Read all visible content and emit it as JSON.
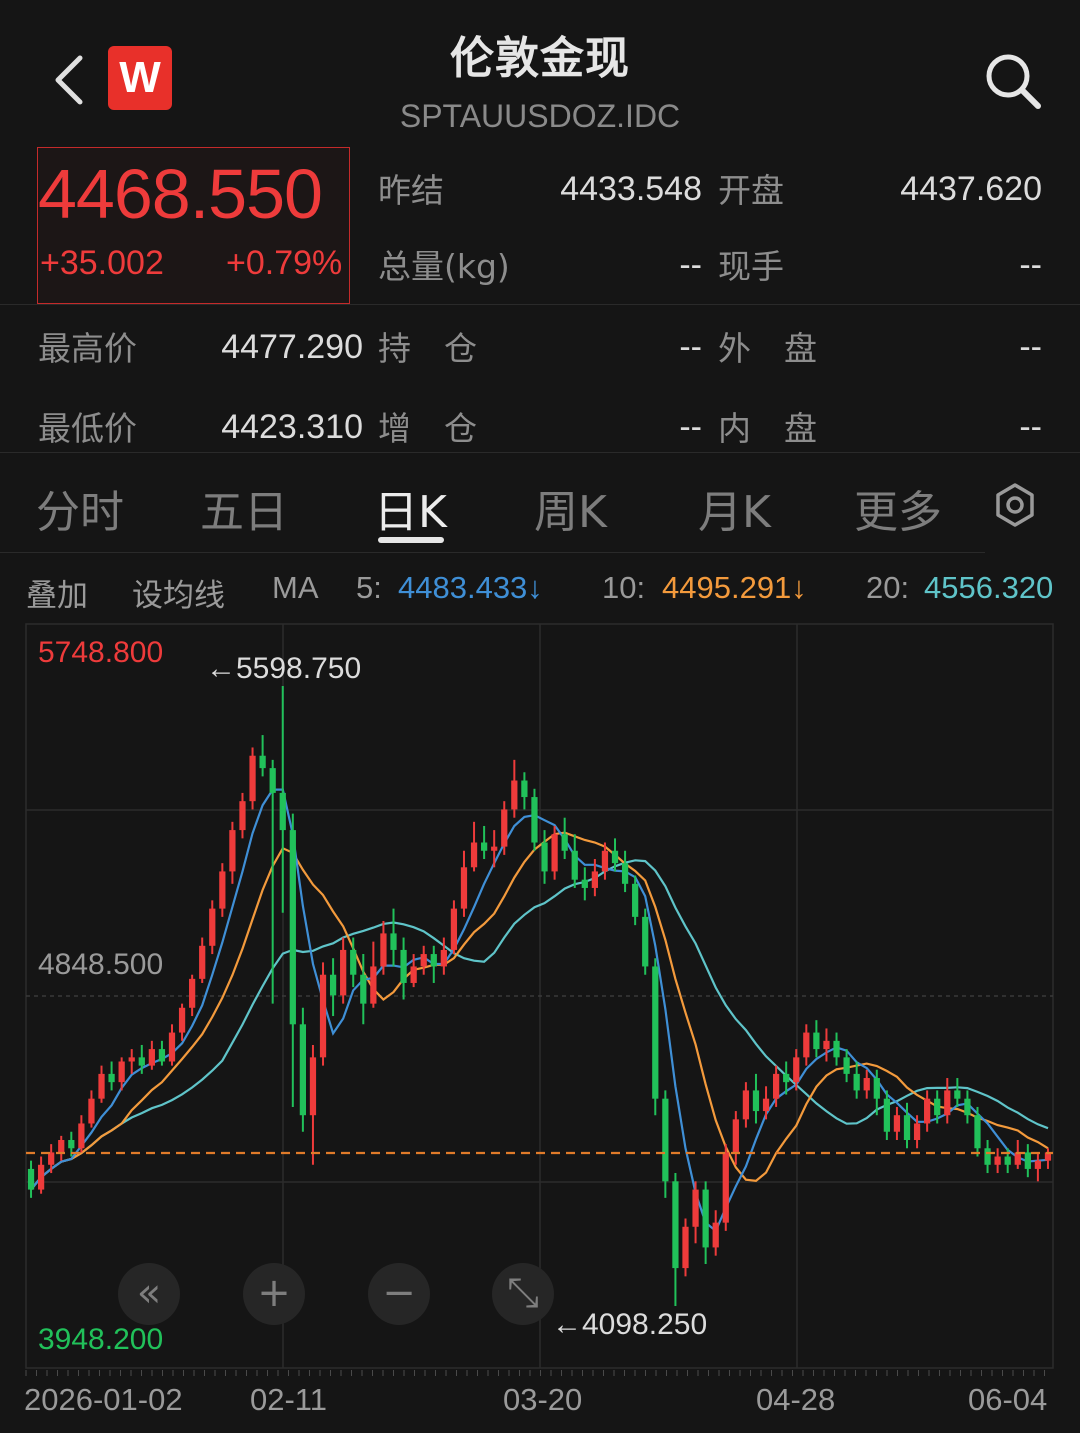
{
  "header": {
    "title": "伦敦金现",
    "code": "SPTAUUSDOZ.IDC",
    "logo_letter": "W"
  },
  "quote": {
    "price": "4468.550",
    "change": "+35.002",
    "change_pct": "+0.79%",
    "prev_close_label": "昨结",
    "prev_close": "4433.548",
    "open_label": "开盘",
    "open": "4437.620",
    "volume_label": "总量(kg)",
    "volume": "--",
    "hand_label": "现手",
    "hand": "--",
    "high_label": "最高价",
    "high": "4477.290",
    "hold_label": "持　仓",
    "hold": "--",
    "outer_label": "外　盘",
    "outer": "--",
    "low_label": "最低价",
    "low": "4423.310",
    "add_label": "增　仓",
    "add": "--",
    "inner_label": "内　盘",
    "inner": "--"
  },
  "tabs": [
    {
      "label": "分时",
      "active": false
    },
    {
      "label": "五日",
      "active": false
    },
    {
      "label": "日K",
      "active": true
    },
    {
      "label": "周K",
      "active": false
    },
    {
      "label": "月K",
      "active": false
    },
    {
      "label": "更多",
      "active": false
    }
  ],
  "ma_bar": {
    "overlay_label": "叠加",
    "setting_label": "设均线",
    "ma_label": "MA",
    "ma5_label": "5:",
    "ma5": "4483.433↓",
    "ma10_label": "10:",
    "ma10": "4495.291↓",
    "ma20_label": "20:",
    "ma20": "4556.320"
  },
  "colors": {
    "up": "#ee3b3b",
    "down": "#21c15a",
    "ma5": "#3f8fd6",
    "ma10": "#f39a3c",
    "ma20": "#5fc4c9",
    "last_line": "#e07b2a"
  },
  "chart_data": {
    "type": "candlestick",
    "y_top_label": "5748.800",
    "y_mid_label": "4848.500",
    "y_bottom_label": "3948.200",
    "ylim": [
      3948.2,
      5748.8
    ],
    "max_annotation": "5598.750",
    "min_annotation": "4098.250",
    "x_tick_labels": [
      "2026-01-02",
      "02-11",
      "03-20",
      "04-28",
      "06-04"
    ],
    "last_price": 4468.55,
    "candles": [
      [
        4430,
        4380,
        4450,
        4360
      ],
      [
        4380,
        4440,
        4460,
        4370
      ],
      [
        4440,
        4470,
        4490,
        4420
      ],
      [
        4470,
        4500,
        4510,
        4450
      ],
      [
        4500,
        4480,
        4520,
        4460
      ],
      [
        4480,
        4540,
        4560,
        4470
      ],
      [
        4540,
        4600,
        4620,
        4530
      ],
      [
        4600,
        4660,
        4680,
        4590
      ],
      [
        4660,
        4640,
        4690,
        4620
      ],
      [
        4640,
        4690,
        4700,
        4620
      ],
      [
        4690,
        4700,
        4720,
        4660
      ],
      [
        4700,
        4680,
        4730,
        4660
      ],
      [
        4680,
        4720,
        4740,
        4670
      ],
      [
        4720,
        4690,
        4740,
        4680
      ],
      [
        4690,
        4760,
        4780,
        4680
      ],
      [
        4760,
        4820,
        4830,
        4740
      ],
      [
        4820,
        4890,
        4900,
        4800
      ],
      [
        4890,
        4970,
        4990,
        4880
      ],
      [
        4970,
        5060,
        5080,
        4950
      ],
      [
        5060,
        5150,
        5170,
        5040
      ],
      [
        5150,
        5250,
        5270,
        5120
      ],
      [
        5250,
        5320,
        5340,
        5230
      ],
      [
        5320,
        5430,
        5450,
        5300
      ],
      [
        5430,
        5400,
        5480,
        5380
      ],
      [
        5400,
        5340,
        5420,
        4830
      ],
      [
        5340,
        5250,
        5598.75,
        5050
      ],
      [
        5250,
        4780,
        5290,
        4580
      ],
      [
        4780,
        4560,
        4820,
        4520
      ],
      [
        4560,
        4700,
        4730,
        4440
      ],
      [
        4700,
        4900,
        4930,
        4680
      ],
      [
        4900,
        4850,
        4940,
        4800
      ],
      [
        4850,
        4960,
        4990,
        4830
      ],
      [
        4960,
        4900,
        4990,
        4870
      ],
      [
        4900,
        4830,
        4950,
        4780
      ],
      [
        4830,
        4920,
        4980,
        4820
      ],
      [
        4920,
        5000,
        5030,
        4900
      ],
      [
        5000,
        4960,
        5060,
        4920
      ],
      [
        4960,
        4880,
        4990,
        4840
      ],
      [
        4880,
        4920,
        4950,
        4870
      ],
      [
        4920,
        4950,
        4970,
        4900
      ],
      [
        4950,
        4920,
        4970,
        4880
      ],
      [
        4920,
        4960,
        4990,
        4900
      ],
      [
        4960,
        5060,
        5080,
        4950
      ],
      [
        5060,
        5160,
        5200,
        5040
      ],
      [
        5160,
        5220,
        5270,
        5150
      ],
      [
        5220,
        5200,
        5260,
        5180
      ],
      [
        5200,
        5210,
        5250,
        5160
      ],
      [
        5210,
        5300,
        5320,
        5190
      ],
      [
        5300,
        5370,
        5420,
        5280
      ],
      [
        5370,
        5330,
        5390,
        5300
      ],
      [
        5330,
        5220,
        5350,
        5200
      ],
      [
        5220,
        5150,
        5250,
        5120
      ],
      [
        5150,
        5240,
        5260,
        5130
      ],
      [
        5240,
        5200,
        5280,
        5180
      ],
      [
        5200,
        5130,
        5240,
        5110
      ],
      [
        5130,
        5110,
        5160,
        5080
      ],
      [
        5110,
        5150,
        5180,
        5090
      ],
      [
        5150,
        5200,
        5220,
        5130
      ],
      [
        5200,
        5170,
        5230,
        5150
      ],
      [
        5170,
        5120,
        5200,
        5100
      ],
      [
        5120,
        5040,
        5140,
        5020
      ],
      [
        5040,
        4920,
        5060,
        4900
      ],
      [
        4920,
        4600,
        4940,
        4560
      ],
      [
        4600,
        4400,
        4620,
        4360
      ],
      [
        4400,
        4190,
        4420,
        4098.25
      ],
      [
        4190,
        4290,
        4310,
        4170
      ],
      [
        4290,
        4380,
        4400,
        4250
      ],
      [
        4380,
        4240,
        4400,
        4200
      ],
      [
        4240,
        4300,
        4330,
        4220
      ],
      [
        4300,
        4470,
        4490,
        4280
      ],
      [
        4470,
        4550,
        4570,
        4440
      ],
      [
        4550,
        4620,
        4640,
        4530
      ],
      [
        4620,
        4570,
        4660,
        4540
      ],
      [
        4570,
        4600,
        4630,
        4550
      ],
      [
        4600,
        4660,
        4680,
        4580
      ],
      [
        4660,
        4640,
        4690,
        4610
      ],
      [
        4640,
        4700,
        4720,
        4620
      ],
      [
        4700,
        4760,
        4780,
        4680
      ],
      [
        4760,
        4720,
        4790,
        4700
      ],
      [
        4720,
        4740,
        4770,
        4690
      ],
      [
        4740,
        4700,
        4760,
        4680
      ],
      [
        4700,
        4660,
        4720,
        4640
      ],
      [
        4660,
        4620,
        4690,
        4600
      ],
      [
        4620,
        4650,
        4670,
        4600
      ],
      [
        4650,
        4600,
        4670,
        4560
      ],
      [
        4600,
        4520,
        4620,
        4500
      ],
      [
        4520,
        4560,
        4580,
        4500
      ],
      [
        4560,
        4500,
        4590,
        4480
      ],
      [
        4500,
        4540,
        4560,
        4480
      ],
      [
        4540,
        4600,
        4620,
        4520
      ],
      [
        4600,
        4560,
        4620,
        4540
      ],
      [
        4560,
        4620,
        4650,
        4540
      ],
      [
        4620,
        4600,
        4650,
        4580
      ],
      [
        4600,
        4560,
        4620,
        4540
      ],
      [
        4560,
        4480,
        4580,
        4460
      ],
      [
        4480,
        4440,
        4500,
        4420
      ],
      [
        4440,
        4460,
        4480,
        4420
      ],
      [
        4460,
        4440,
        4480,
        4420
      ],
      [
        4440,
        4470,
        4500,
        4430
      ],
      [
        4470,
        4430,
        4490,
        4410
      ],
      [
        4430,
        4450,
        4470,
        4400
      ],
      [
        4450,
        4470,
        4480,
        4430
      ]
    ],
    "ma5_end": 4483.433,
    "ma10_end": 4495.291,
    "ma20_end": 4556.32
  },
  "zoom_controls": {
    "prev": "«",
    "zoom_in": "+",
    "zoom_out": "−",
    "expand": "⤡"
  }
}
